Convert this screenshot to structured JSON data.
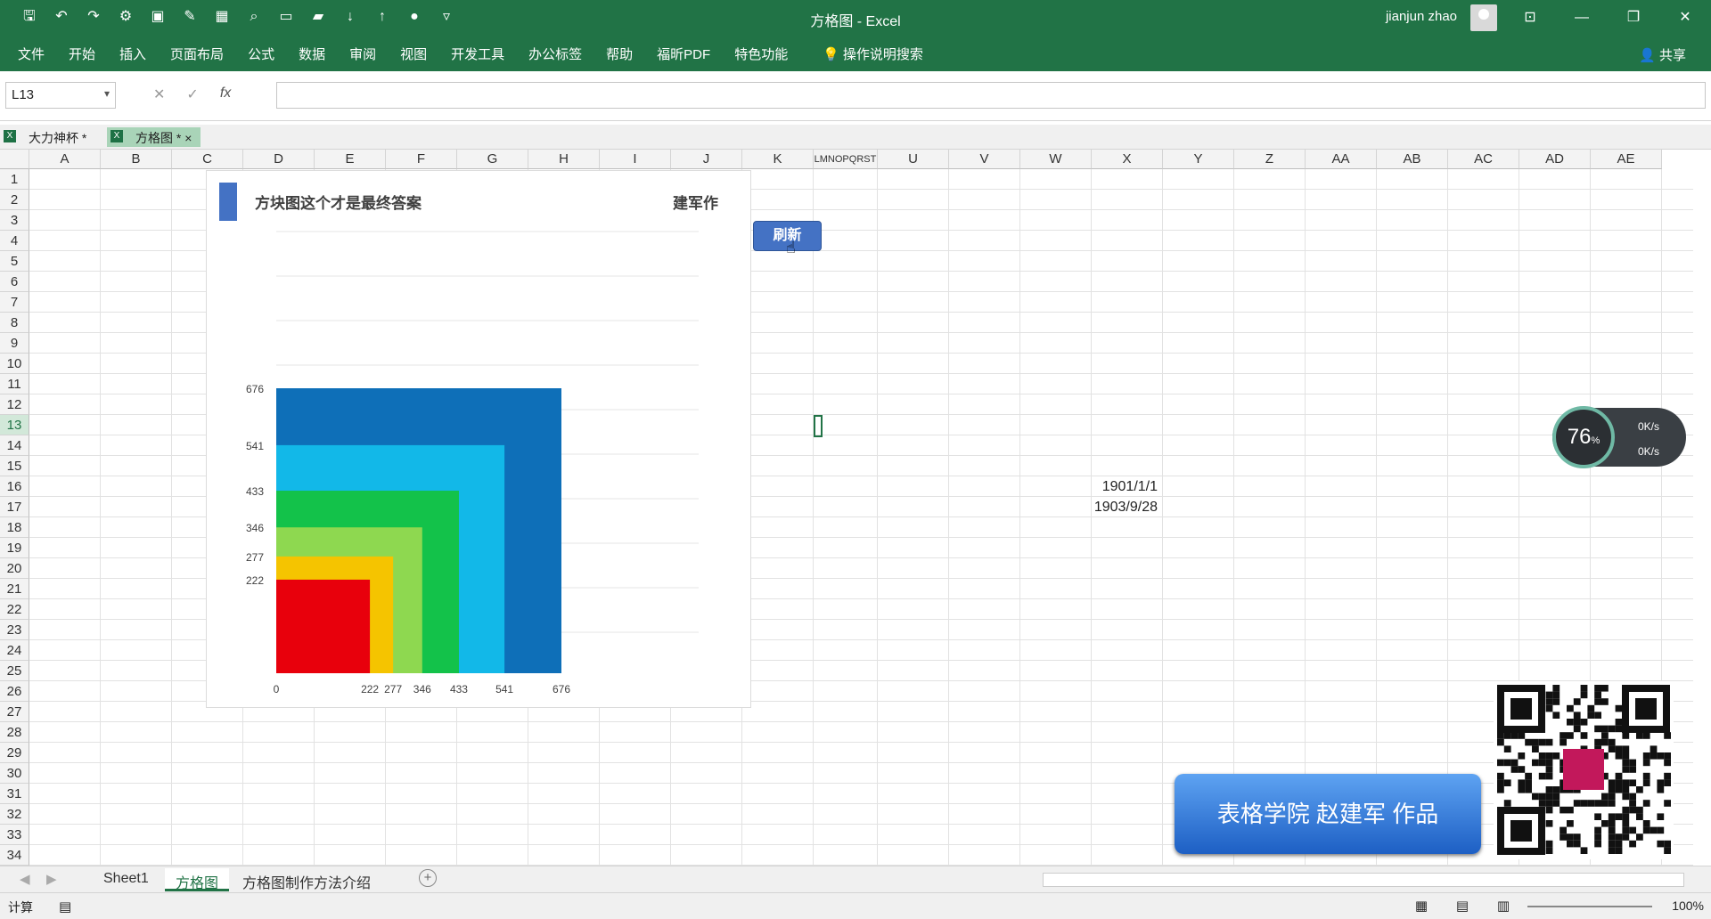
{
  "titlebar": {
    "title": "方格图  -  Excel",
    "user": "jianjun zhao"
  },
  "ribbon": {
    "tabs": [
      "文件",
      "开始",
      "插入",
      "页面布局",
      "公式",
      "数据",
      "审阅",
      "视图",
      "开发工具",
      "办公标签",
      "帮助",
      "福昕PDF",
      "特色功能"
    ],
    "tellme": "操作说明搜索",
    "share": "共享"
  },
  "formula": {
    "namebox": "L13",
    "fx": "fx"
  },
  "doctabs": [
    "大力神杯 *",
    "方格图 *"
  ],
  "columns": [
    "A",
    "B",
    "C",
    "D",
    "E",
    "F",
    "G",
    "H",
    "I",
    "J",
    "K",
    "LMNOPQRST",
    "U",
    "V",
    "W",
    "X",
    "Y",
    "Z",
    "AA",
    "AB",
    "AC",
    "AD",
    "AE"
  ],
  "rows": [
    "1",
    "2",
    "3",
    "4",
    "5",
    "6",
    "7",
    "8",
    "9",
    "10",
    "11",
    "12",
    "13",
    "14",
    "15",
    "16",
    "17",
    "18",
    "19",
    "20",
    "21",
    "22",
    "23",
    "24",
    "25",
    "26",
    "27",
    "28",
    "29",
    "30",
    "31",
    "32",
    "33",
    "34"
  ],
  "cells": {
    "x16": "1901/1/1",
    "x17": "1903/9/28"
  },
  "chart": {
    "title": "方块图这个才是最终答案",
    "author": "建军作"
  },
  "chart_data": {
    "type": "area",
    "title": "方块图这个才是最终答案",
    "xlim": [
      0,
      676
    ],
    "ylim": [
      0,
      676
    ],
    "yticks": [
      676,
      541,
      433,
      346,
      277,
      222
    ],
    "xticks": [
      0,
      222,
      277,
      346,
      433,
      541,
      676
    ],
    "squares": [
      {
        "size": 676,
        "color": "#0e6fb8"
      },
      {
        "size": 541,
        "color": "#12b8e8"
      },
      {
        "size": 433,
        "color": "#13c24a"
      },
      {
        "size": 346,
        "color": "#8ed850"
      },
      {
        "size": 277,
        "color": "#f5c400"
      },
      {
        "size": 222,
        "color": "#e8000c"
      }
    ]
  },
  "refresh_button": "刷新",
  "net": {
    "cpu": "76",
    "unit": "%",
    "up": "0K/s",
    "down": "0K/s"
  },
  "banner": "表格学院 赵建军 作品",
  "sheets": [
    "Sheet1",
    "方格图",
    "方格图制作方法介绍"
  ],
  "status": {
    "mode": "计算",
    "zoom": "100%"
  }
}
